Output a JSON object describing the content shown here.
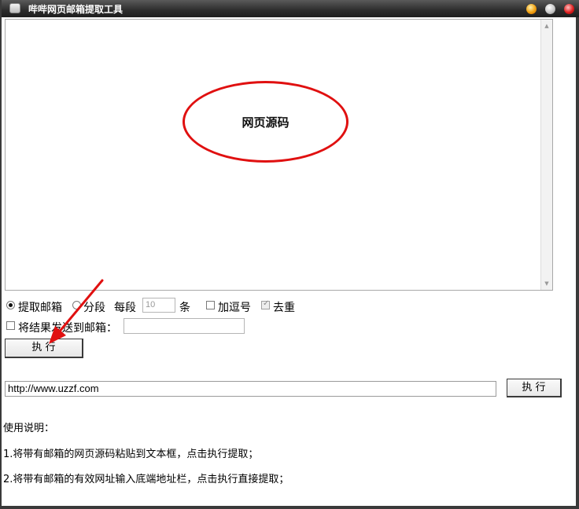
{
  "window": {
    "title": "哔哔网页邮箱提取工具"
  },
  "source_area": {
    "annotation_label": "网页源码",
    "annotation_color": "#e01010"
  },
  "options": {
    "extract_email_label": "提取邮箱",
    "extract_email_selected": true,
    "segment_label": "分段",
    "segment_selected": false,
    "per_segment_label": "每段",
    "per_segment_value": "10",
    "per_segment_unit": "条",
    "add_comma_label": "加逗号",
    "add_comma_checked": false,
    "dedupe_label": "去重",
    "dedupe_checked": true,
    "send_to_email_label": "将结果发送到邮箱：",
    "send_to_email_checked": false,
    "email_value": ""
  },
  "buttons": {
    "execute_1": "执  行",
    "execute_2": "执 行"
  },
  "url_bar": {
    "value": "http://www.uzzf.com"
  },
  "usage": {
    "title": "使用说明：",
    "line1": "1.将带有邮箱的网页源码粘贴到文本框，点击执行提取；",
    "line2": "2.将带有邮箱的有效网址输入底端地址栏，点击执行直接提取；"
  },
  "annotation_arrow_color": "#e01010"
}
